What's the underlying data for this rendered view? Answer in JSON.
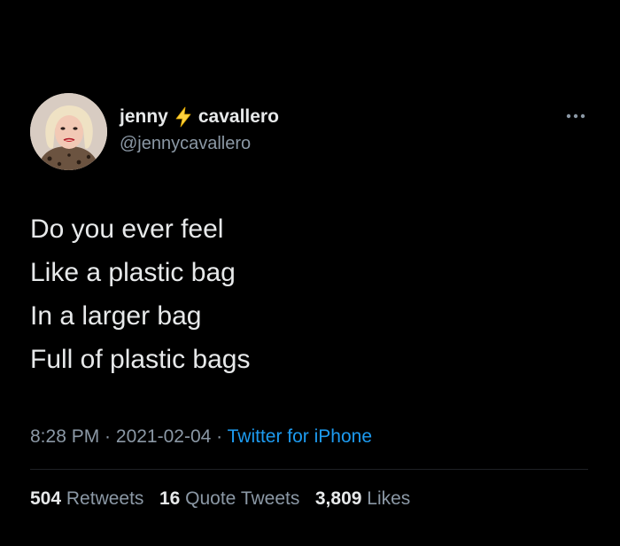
{
  "tweet": {
    "author": {
      "name_first": "jenny",
      "name_last": "cavallero",
      "handle": "@jennycavallero",
      "emoji": "high-voltage-icon",
      "avatar": "profile-photo"
    },
    "more_icon": "more-options-icon",
    "lines": [
      "Do you ever feel",
      "Like a plastic bag",
      "In a larger bag",
      "Full of plastic bags"
    ],
    "meta": {
      "time": "8:28 PM",
      "separator": " · ",
      "date": "2021-02-04",
      "source": "Twitter for iPhone"
    },
    "stats": {
      "retweets_count": "504",
      "retweets_label": "Retweets",
      "quotes_count": "16",
      "quotes_label": "Quote Tweets",
      "likes_count": "3,809",
      "likes_label": "Likes"
    }
  },
  "colors": {
    "background": "#000000",
    "primary_text": "#e7e9ea",
    "secondary_text": "#8b98a5",
    "link": "#1d9bf0",
    "emoji": "#ffd23f"
  }
}
